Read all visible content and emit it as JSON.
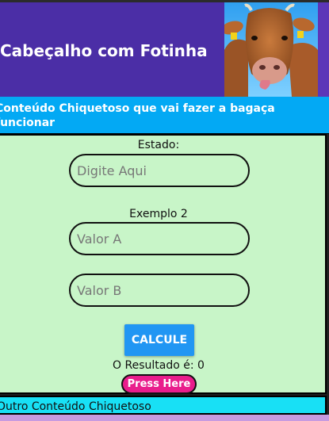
{
  "header": {
    "title": "Cabeçalho com Fotinha",
    "background": "#4b2ea6",
    "right_band_color": "#5c36b8"
  },
  "section": {
    "title": "Conteúdo Chiquetoso que vai fazer a bagaça funcionar",
    "background": "#03a9f4"
  },
  "form": {
    "background": "#c8f5c8",
    "estado_label": "Estado:",
    "estado_placeholder": "Digite Aqui",
    "exemplo_label": "Exemplo 2",
    "valor_a_placeholder": "Valor A",
    "valor_b_placeholder": "Valor B",
    "calc_label": "CALCULE",
    "result_text": "O Resultado é: 0",
    "press_label": "Press Here"
  },
  "other": {
    "text": "Outro Conteúdo Chiquetoso",
    "background": "#18e0f5"
  },
  "footer": {
    "color": "#c79be0"
  }
}
